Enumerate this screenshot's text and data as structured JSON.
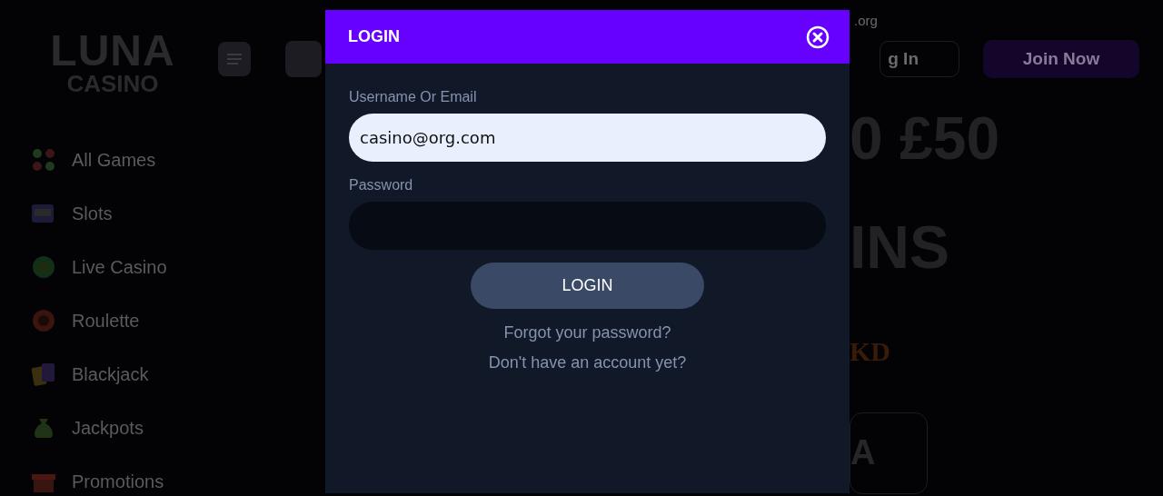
{
  "logo": {
    "line_1": "LUNA",
    "line_2": "CASINO"
  },
  "sidebar": {
    "items": [
      {
        "label": "All Games"
      },
      {
        "label": "Slots"
      },
      {
        "label": "Live Casino"
      },
      {
        "label": "Roulette"
      },
      {
        "label": "Blackjack"
      },
      {
        "label": "Jackpots"
      },
      {
        "label": "Promotions"
      }
    ]
  },
  "header": {
    "site_text": ".org",
    "login_button": "g In",
    "join_button": "Join Now"
  },
  "hero": {
    "headline_1": "0 £50",
    "headline_2": "INS",
    "badge": "KD",
    "button": "A"
  },
  "modal": {
    "title": "LOGIN",
    "fields": [
      {
        "label": "Username Or Email",
        "value": "casino@org.com"
      },
      {
        "label": "Password"
      }
    ],
    "submit": "LOGIN",
    "links": [
      "Forgot your password?",
      "Don't have an account yet?"
    ]
  }
}
